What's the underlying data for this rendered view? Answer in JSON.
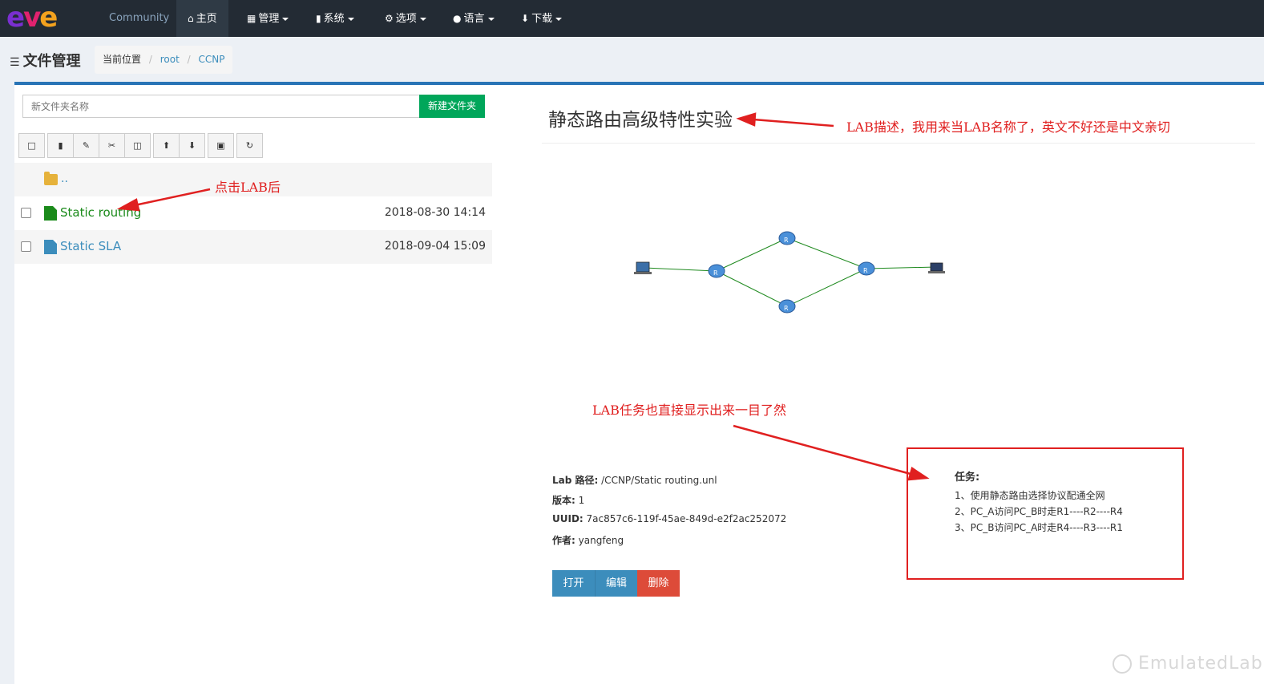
{
  "navbar": {
    "logo": "eve",
    "community": "Community",
    "home": "主页",
    "manage": "管理",
    "system": "系统",
    "options": "选项",
    "language": "语言",
    "download": "下载"
  },
  "header": {
    "title": "文件管理",
    "breadcrumb": {
      "label": "当前位置",
      "items": [
        "root",
        "CCNP"
      ]
    }
  },
  "file_manager": {
    "new_folder_placeholder": "新文件夹名称",
    "new_folder_button": "新建文件夹",
    "parent_dir": "..",
    "files": [
      {
        "name": "Static routing",
        "date": "2018-08-30 14:14"
      },
      {
        "name": "Static SLA",
        "date": "2018-09-04 15:09"
      }
    ]
  },
  "lab": {
    "title": "静态路由高级特性实验",
    "path_label": "Lab 路径:",
    "path": "/CCNP/Static routing.unl",
    "version_label": "版本:",
    "version": "1",
    "uuid_label": "UUID:",
    "uuid": "7ac857c6-119f-45ae-849d-e2f2ac252072",
    "author_label": "作者:",
    "author": "yangfeng",
    "buttons": {
      "open": "打开",
      "edit": "编辑",
      "delete": "删除"
    },
    "task_title": "任务:",
    "tasks": [
      "1、使用静态路由选择协议配通全网",
      "2、PC_A访问PC_B时走R1----R2----R4",
      "3、PC_B访问PC_A时走R4----R3----R1"
    ]
  },
  "annotations": {
    "click_lab": "点击LAB后",
    "lab_desc": "LAB描述，我用来当LAB名称了，英文不好还是中文亲切",
    "lab_task": "LAB任务也直接显示出来一目了然"
  },
  "watermark": "EmulatedLab",
  "colors": {
    "navbar": "#232b34",
    "accent": "#2874b6",
    "success": "#00a65a",
    "danger": "#dd4b39",
    "primary": "#3c8dbc",
    "annotation": "#e02020"
  }
}
